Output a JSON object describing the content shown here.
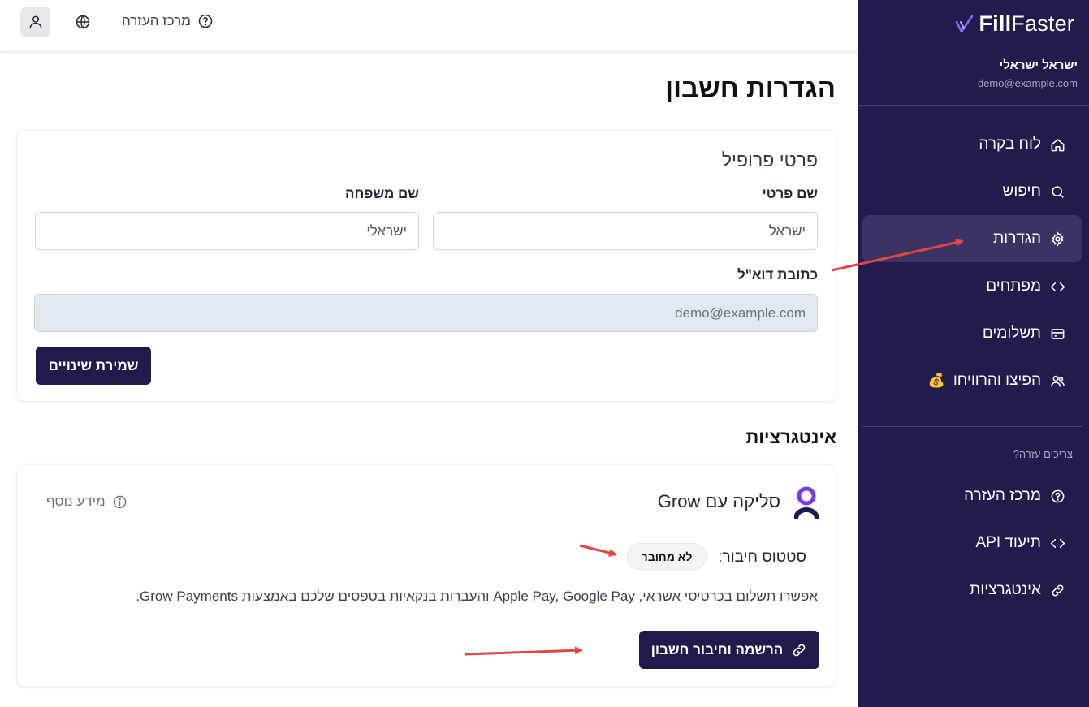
{
  "brand": {
    "name_bold": "Fill",
    "name_light": "Faster",
    "accent": "#7c6cf0"
  },
  "sidebar": {
    "user_name": "ישראל ישראלי",
    "user_email": "demo@example.com",
    "items": [
      {
        "label": "לוח בקרה",
        "icon": "home-icon"
      },
      {
        "label": "חיפוש",
        "icon": "search-icon"
      },
      {
        "label": "הגדרות",
        "icon": "gear-icon",
        "active": true
      },
      {
        "label": "מפתחים",
        "icon": "code-icon"
      },
      {
        "label": "תשלומים",
        "icon": "card-icon"
      },
      {
        "label": "הפיצו והרוויחו",
        "icon": "users-icon",
        "emoji": "💰"
      }
    ],
    "help_title": "צריכים עזרה?",
    "help_items": [
      {
        "label": "מרכז העזרה",
        "icon": "help-icon"
      },
      {
        "label": "תיעוד API",
        "icon": "code-icon"
      },
      {
        "label": "אינטגרציות",
        "icon": "link-icon"
      }
    ]
  },
  "topbar": {
    "help_label": "מרכז העזרה"
  },
  "page": {
    "title": "הגדרות חשבון"
  },
  "profile": {
    "title": "פרטי פרופיל",
    "first_name_label": "שם פרטי",
    "first_name_value": "ישראל",
    "last_name_label": "שם משפחה",
    "last_name_value": "ישראלי",
    "email_label": "כתובת דוא\"ל",
    "email_value": "demo@example.com",
    "save_label": "שמירת שינויים"
  },
  "integrations": {
    "title": "אינטגרציות",
    "grow": {
      "name": "סליקה עם Grow",
      "more_info": "מידע נוסף",
      "status_label": "סטטוס חיבור:",
      "status_value": "לא מחובר",
      "description": "אפשרו תשלום בכרטיסי אשראי, Apple Pay, Google Pay והעברות בנקאיות בטפסים שלכם באמצעות Grow Payments.",
      "connect_label": "הרשמה וחיבור חשבון"
    }
  },
  "colors": {
    "sidebar_bg": "#231a4e",
    "primary": "#211a4d",
    "annotation_arrow": "#e34545"
  }
}
